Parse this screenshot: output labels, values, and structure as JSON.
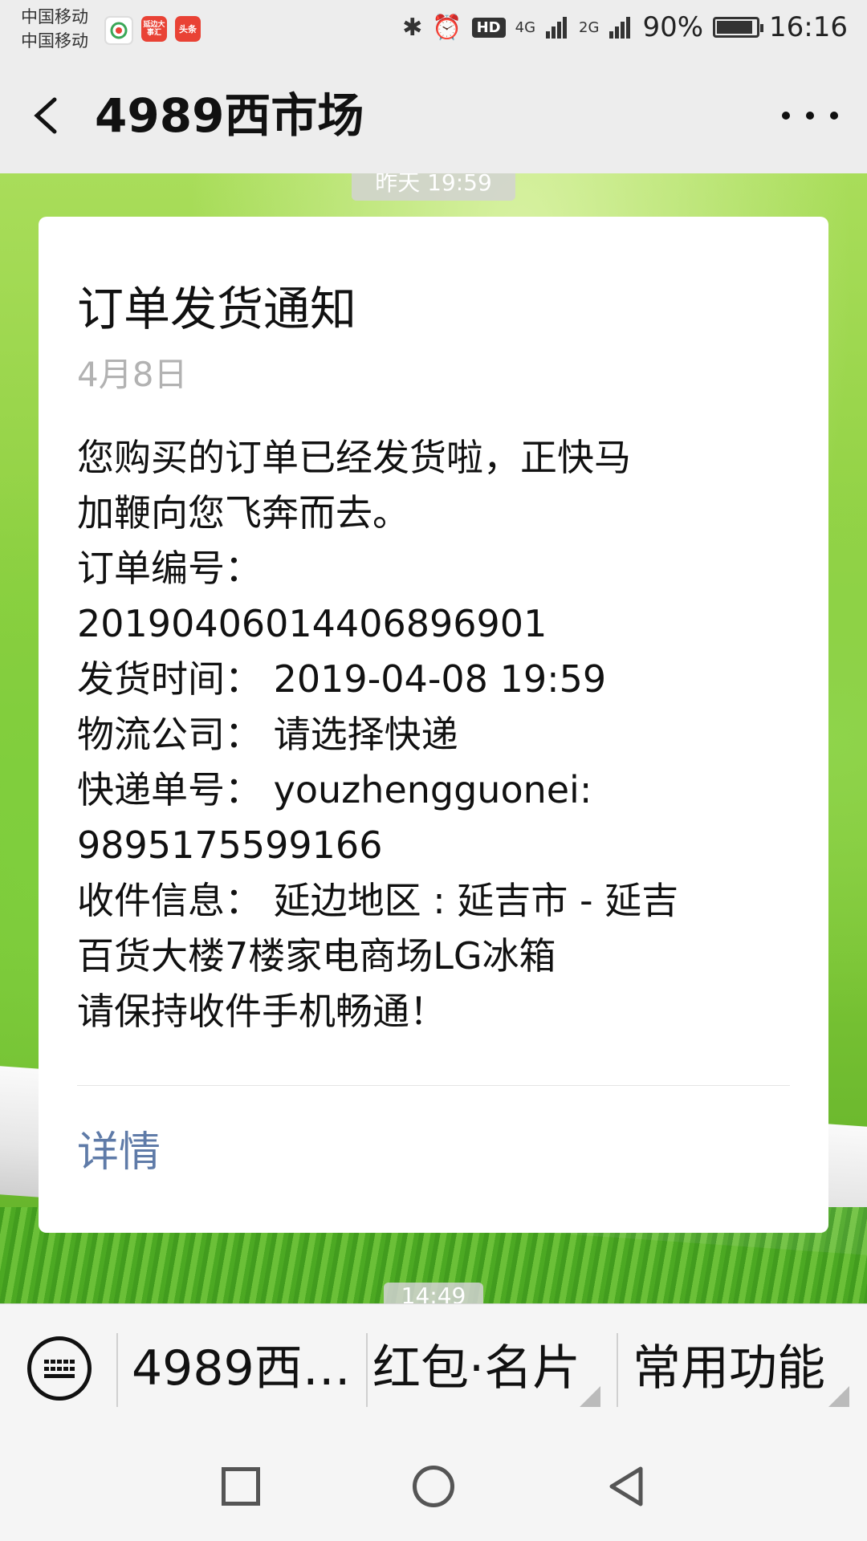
{
  "status_bar": {
    "carrier_1": "中国移动",
    "carrier_2": "中国移动",
    "app_icons": [
      "wechat-icon",
      "news-icon",
      "toutiao-icon"
    ],
    "app_icon_labels": {
      "app2": "延边大事汇",
      "app3": "头条"
    },
    "network_1": "4G",
    "network_2": "2G",
    "battery": "90%",
    "time": "16:16"
  },
  "header": {
    "title": "4989西市场",
    "back_icon": "chevron-left-icon",
    "more_icon": "more-icon"
  },
  "chat": {
    "time_top": "昨天 19:59",
    "time_bottom": "14:49"
  },
  "card": {
    "title": "订单发货通知",
    "date": "4月8日",
    "lines": [
      "您购买的订单已经发货啦，正快马",
      "加鞭向您飞奔而去。",
      "订单编号：",
      "201904060144068969​01",
      "发货时间：  2019-04-08 19:59",
      "物流公司：  请选择快递",
      "快递单号：  youzhengguonei:",
      "9895175599166",
      "收件信息：  延边地区 : 延吉市 - 延吉",
      "百货大楼7楼家电商场LG冰箱",
      "请保持收件手机畅通！"
    ],
    "link": "详情"
  },
  "menu": {
    "keyboard_icon": "keyboard-icon",
    "items": [
      "4989西…",
      "红包·名片",
      "常用功能"
    ]
  },
  "navbar": {
    "icons": [
      "square-icon",
      "circle-icon",
      "triangle-back-icon"
    ]
  },
  "colors": {
    "link": "#5f7ba8",
    "date": "#b2b2b2",
    "bar_bg": "#ededed"
  }
}
